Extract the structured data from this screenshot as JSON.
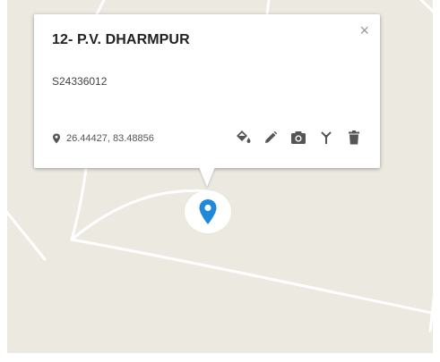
{
  "popup": {
    "title": "12- P.V. DHARMPUR",
    "code": "S24336012",
    "coordinates": "26.44427, 83.48856",
    "close_label": "×"
  },
  "icons": {
    "coord_pin": "map-pin-icon",
    "paint": "paint-bucket-icon",
    "edit": "pencil-icon",
    "camera": "camera-icon",
    "antenna": "antenna-icon",
    "delete": "trash-icon",
    "marker": "map-marker-icon"
  },
  "colors": {
    "map_background": "#ece9e1",
    "road": "#ffffff",
    "marker": "#1e88d9",
    "icon": "#555555"
  }
}
